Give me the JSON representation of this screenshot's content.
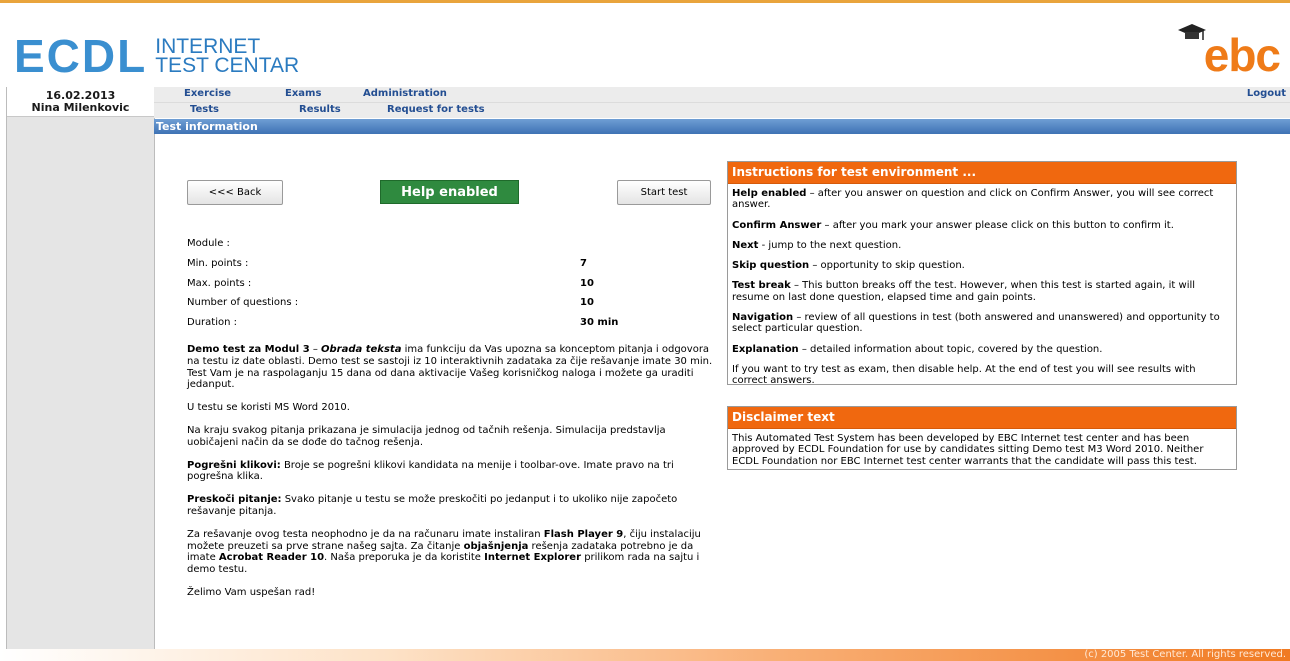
{
  "header": {
    "logo_main": "ECDL",
    "logo_sub_line1": "INTERNET",
    "logo_sub_line2": "TEST CENTAR",
    "brand_right": "ebc"
  },
  "user": {
    "date": "16.02.2013",
    "name": "Nina Milenkovic"
  },
  "nav": {
    "row1": [
      "Exercise",
      "Exams",
      "Administration"
    ],
    "row2": [
      "Tests",
      "Results",
      "Request for tests"
    ],
    "logout": "Logout"
  },
  "section_title": "Test information",
  "buttons": {
    "back": "<<< Back",
    "help": "Help enabled",
    "start": "Start test"
  },
  "info": [
    {
      "label": "Module :",
      "value": ""
    },
    {
      "label": "Min. points :",
      "value": "7"
    },
    {
      "label": "Max. points :",
      "value": "10"
    },
    {
      "label": "Number of questions :",
      "value": "10"
    },
    {
      "label": "Duration :",
      "value": "30 min"
    }
  ],
  "description": {
    "p1_b1": "Demo test za Modul 3",
    "p1_t1": " – ",
    "p1_bi": "Obrada teksta",
    "p1_t2": " ima funkciju da Vas upozna sa konceptom pitanja i odgovora na testu iz date oblasti. Demo test se sastoji iz 10 interaktivnih zadataka za čije rešavanje imate 30 min. Test Vam je na raspolaganju 15 dana od dana aktivacije Vašeg korisničkog naloga i možete ga uraditi jedanput.",
    "p2": "U testu se koristi MS Word 2010.",
    "p3": "Na kraju svakog pitanja prikazana je simulacija jednog od tačnih rešenja. Simulacija predstavlja uobičajeni način da se dođe do tačnog rešenja.",
    "p4_b": "Pogrešni klikovi:",
    "p4_t": " Broje se pogrešni klikovi kandidata na menije i toolbar-ove. Imate pravo na tri pogrešna klika.",
    "p5_b": "Preskoči pitanje:",
    "p5_t": " Svako pitanje u testu se može preskočiti po jedanput i to ukoliko nije započeto rešavanje pitanja.",
    "p6_t1": "Za rešavanje ovog testa neophodno je da na računaru imate instaliran ",
    "p6_b1": "Flash Player 9",
    "p6_t2": ", čiju instalaciju možete preuzeti sa prve strane našeg sajta. Za čitanje ",
    "p6_b2": "objašnjenja",
    "p6_t3": " rešenja zadataka potrebno je da imate ",
    "p6_b3": "Acrobat Reader 10",
    "p6_t4": ". Naša preporuka je da koristite ",
    "p6_b4": "Internet Explorer",
    "p6_t5": " prilikom rada na sajtu i demo testu.",
    "p7": "Želimo Vam uspešan rad!"
  },
  "instructions": {
    "title": "Instructions for test environment ...",
    "items": [
      {
        "term": "Help enabled",
        "text": " – after you answer on question and click on Confirm Answer, you will see correct answer."
      },
      {
        "term": "Confirm Answer",
        "text": " – after you mark your answer please click on this button to confirm it."
      },
      {
        "term": "Next",
        "text": " - jump to the next question."
      },
      {
        "term": "Skip question",
        "text": " – opportunity to skip question."
      },
      {
        "term": "Test break",
        "text": " – This button breaks off the test. However, when this test is started again, it will resume on last done question, elapsed time and gain points."
      },
      {
        "term": "Navigation",
        "text": " – review of all questions in test (both answered and unanswered) and opportunity to select particular question."
      },
      {
        "term": "Explanation",
        "text": " – detailed information about topic, covered by the question."
      }
    ],
    "footer": "If you want to try test as exam, then disable help. At the end of test you will see results with correct answers."
  },
  "disclaimer": {
    "title": "Disclaimer text",
    "text": "This Automated Test System has been developed by EBC Internet test center and has been approved by ECDL Foundation for use by candidates sitting Demo test M3 Word 2010. Neither ECDL Foundation nor EBC Internet test center warrants that the candidate will pass this test."
  },
  "footer": "(c) 2005 Test Center. All rights reserved."
}
